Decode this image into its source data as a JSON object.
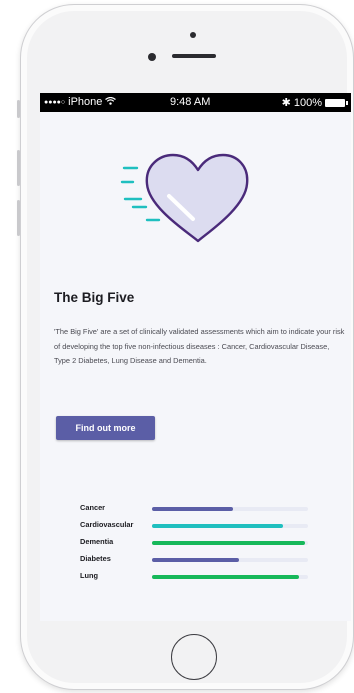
{
  "status_bar": {
    "signal_dots": "●●●●○",
    "carrier": "iPhone",
    "time": "9:48 AM",
    "bluetooth": "✱",
    "battery_pct": "100%"
  },
  "content": {
    "title": "The Big Five",
    "description": "'The Big Five' are a set of clinically validated assessments which aim to indicate your risk of developing the top five non-infectious diseases : Cancer, Cardiovascular Disease, Type 2 Diabetes, Lung Disease and Dementia.",
    "cta_label": "Find out more"
  },
  "risk_bars": [
    {
      "label": "Cancer",
      "value": 0.52,
      "color": "#5b5ea6"
    },
    {
      "label": "Cardiovascular",
      "value": 0.84,
      "color": "#1fbfbf"
    },
    {
      "label": "Dementia",
      "value": 0.98,
      "color": "#16b85a"
    },
    {
      "label": "Diabetes",
      "value": 0.56,
      "color": "#5b5ea6"
    },
    {
      "label": "Lung",
      "value": 0.94,
      "color": "#16b85a"
    }
  ],
  "colors": {
    "accent": "#5b5ea6",
    "heart_stroke": "#4a2a7a",
    "heart_fill": "#dcdcf0",
    "speed_lines": "#1fbfbf"
  },
  "icons": {
    "hero": "heart-icon",
    "wifi": "wifi-icon",
    "bluetooth": "bluetooth-icon",
    "battery": "battery-icon"
  }
}
